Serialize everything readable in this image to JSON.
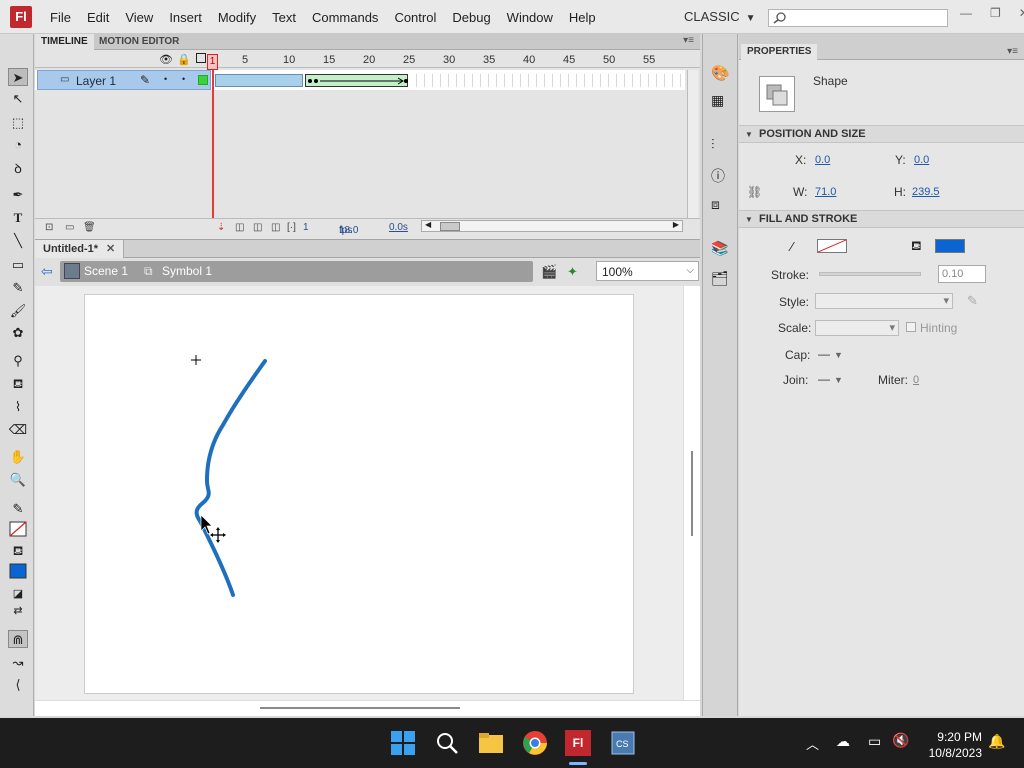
{
  "app": {
    "logo": "Fl",
    "menus": [
      "File",
      "Edit",
      "View",
      "Insert",
      "Modify",
      "Text",
      "Commands",
      "Control",
      "Debug",
      "Window",
      "Help"
    ],
    "workspace": "CLASSIC",
    "search_placeholder": ""
  },
  "timeline": {
    "tabs": {
      "timeline": "TIMELINE",
      "motion_editor": "MOTION EDITOR"
    },
    "frame_numbers": [
      "1",
      "5",
      "10",
      "15",
      "20",
      "25",
      "30",
      "35",
      "40",
      "45",
      "50",
      "55"
    ],
    "layer_name": "Layer 1",
    "playhead_frame": "1",
    "status": {
      "current_frame": "1",
      "fps": "18.0",
      "fps_unit": "fps",
      "elapsed": "0.0s"
    }
  },
  "document": {
    "tab_title": "Untitled-1*",
    "breadcrumb": {
      "scene": "Scene 1",
      "symbol": "Symbol 1"
    },
    "zoom": "100%"
  },
  "properties": {
    "panel_title": "PROPERTIES",
    "object_type": "Shape",
    "position_size": {
      "header": "POSITION AND SIZE",
      "x_label": "X:",
      "x": "0.0",
      "y_label": "Y:",
      "y": "0.0",
      "w_label": "W:",
      "w": "71.0",
      "h_label": "H:",
      "h": "239.5"
    },
    "fill_stroke": {
      "header": "FILL AND STROKE",
      "fill_color": "#0a64d2",
      "stroke_label": "Stroke:",
      "stroke": "0.10",
      "style_label": "Style:",
      "scale_label": "Scale:",
      "hinting_label": "Hinting",
      "cap_label": "Cap:",
      "cap": "—",
      "join_label": "Join:",
      "join": "—",
      "miter_label": "Miter:",
      "miter": "0"
    }
  },
  "taskbar": {
    "time": "9:20 PM",
    "date": "10/8/2023"
  }
}
